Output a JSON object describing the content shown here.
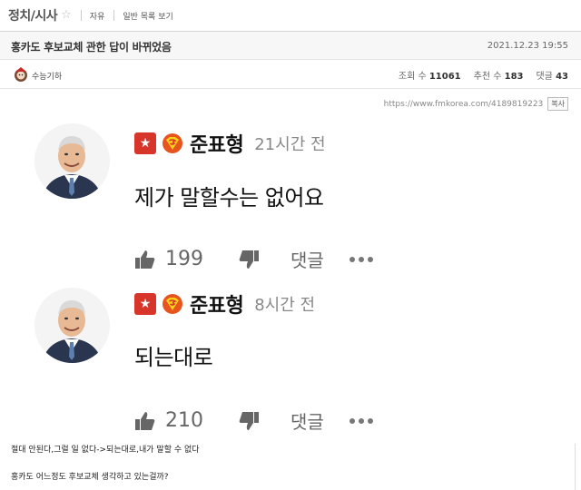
{
  "board": {
    "name": "정치/시사",
    "links": [
      "자유",
      "일반 목록 보기"
    ]
  },
  "post": {
    "title": "홍카도 후보교체 관한 답이 바뀌었음",
    "date": "2021.12.23 19:55",
    "author": "수능기하",
    "views_label": "조회 수",
    "views": "11061",
    "recommend_label": "추천 수",
    "recommend": "183",
    "comments_label": "댓글",
    "comments": "43",
    "url": "https://www.fmkorea.com/4189819223",
    "copy_label": "복사"
  },
  "comments": [
    {
      "name": "준표형",
      "time": "21시간 전",
      "text": "제가 말할수는 없어요",
      "likes": "199",
      "reply_label": "댓글"
    },
    {
      "name": "준표형",
      "time": "8시간 전",
      "text": "되는대로",
      "likes": "210",
      "reply_label": "댓글"
    }
  ],
  "body": {
    "line1": "절대 안된다,그럴 일 없다->되는대로,내가 말할 수 없다",
    "line2": "홍카도 어느정도 후보교체 생각하고 있는걸까?"
  },
  "colors": {
    "badge_red": "#d8352a",
    "super_orange": "#e8541e"
  }
}
